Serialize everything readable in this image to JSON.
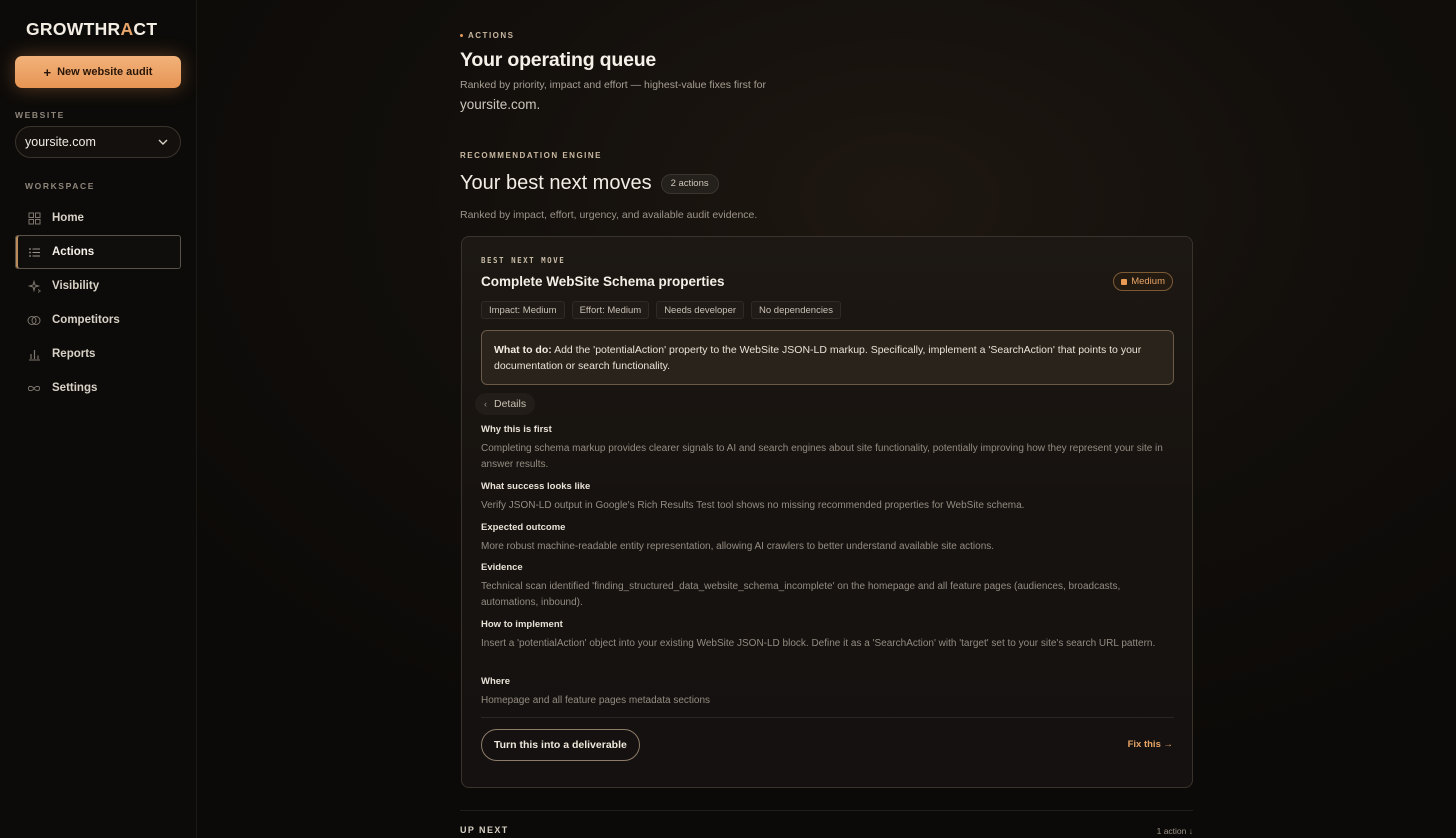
{
  "brand": {
    "logo_main": "GROWTHR",
    "logo_accent": "A",
    "logo_end": "CT",
    "accent_color": "#e79554"
  },
  "sidebar": {
    "new_audit_label": "New website audit",
    "website_label": "WEBSITE",
    "website_value": "yoursite.com",
    "workspace_label": "WORKSPACE",
    "items": [
      {
        "label": "Home",
        "icon": "grid-icon",
        "active": false
      },
      {
        "label": "Actions",
        "icon": "list-icon",
        "active": true
      },
      {
        "label": "Visibility",
        "icon": "sparkle-icon",
        "active": false
      },
      {
        "label": "Competitors",
        "icon": "circles-icon",
        "active": false
      },
      {
        "label": "Reports",
        "icon": "bar-chart-icon",
        "active": false
      },
      {
        "label": "Settings",
        "icon": "infinity-icon",
        "active": false
      }
    ]
  },
  "header": {
    "eyebrow": "ACTIONS",
    "title": "Your operating queue",
    "subtitle": "Ranked by priority, impact and effort — highest-value fixes first for",
    "site": "yoursite.com."
  },
  "engine": {
    "label": "RECOMMENDATION ENGINE",
    "title": "Your best next moves",
    "count": "2 actions",
    "subtitle": "Ranked by impact, effort, urgency, and available audit evidence."
  },
  "card": {
    "eyebrow": "BEST NEXT MOVE",
    "title": "Complete WebSite Schema properties",
    "priority": "Medium",
    "tags": [
      "Impact: Medium",
      "Effort: Medium",
      "Needs developer",
      "No dependencies"
    ],
    "todo_label": "What to do:",
    "todo_text": " Add the 'potentialAction' property to the WebSite JSON-LD markup. Specifically, implement a 'SearchAction' that points to your documentation or search functionality.",
    "details_label": "Details",
    "sections": [
      {
        "heading": "Why this is first",
        "body": "Completing schema markup provides clearer signals to AI and search engines about site functionality, potentially improving how they represent your site in answer results."
      },
      {
        "heading": "What success looks like",
        "body": "Verify JSON-LD output in Google's Rich Results Test tool shows no missing recommended properties for WebSite schema."
      },
      {
        "heading": "Expected outcome",
        "body": "More robust machine-readable entity representation, allowing AI crawlers to better understand available site actions."
      },
      {
        "heading": "Evidence",
        "body": "Technical scan identified 'finding_structured_data_website_schema_incomplete' on the homepage and all feature pages (audiences, broadcasts, automations, inbound)."
      },
      {
        "heading": "How to implement",
        "body": "Insert a 'potentialAction' object into your existing WebSite JSON-LD block. Define it as a 'SearchAction' with 'target' set to your site's search URL pattern."
      },
      {
        "heading": "Where",
        "body": "Homepage and all feature pages metadata sections"
      }
    ],
    "deliverable_label": "Turn this into a deliverable",
    "fix_label": "Fix this →"
  },
  "upnext": {
    "label": "UP NEXT",
    "count": "1 action ↓"
  }
}
